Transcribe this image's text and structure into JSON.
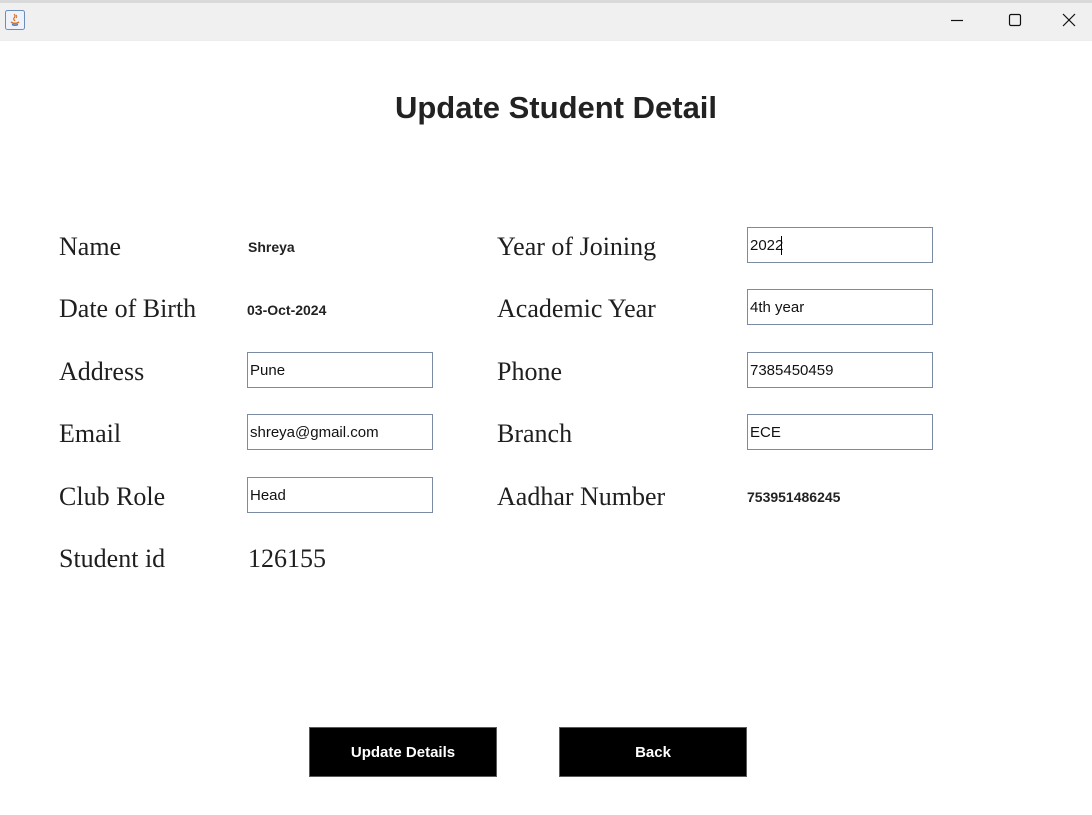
{
  "window": {
    "title": "",
    "controls": {
      "minimize_icon": "minimize-icon",
      "maximize_icon": "maximize-icon",
      "close_icon": "close-icon"
    }
  },
  "page_title": "Update Student Detail",
  "left_column": {
    "name": {
      "label": "Name",
      "value": "Shreya"
    },
    "date_of_birth": {
      "label": "Date of Birth",
      "value": "03-Oct-2024"
    },
    "address": {
      "label": "Address",
      "value": "Pune"
    },
    "email": {
      "label": "Email",
      "value": "shreya@gmail.com"
    },
    "club_role": {
      "label": "Club Role",
      "value": "Head"
    },
    "student_id": {
      "label": "Student id",
      "value": "126155"
    }
  },
  "right_column": {
    "year_of_joining": {
      "label": "Year of Joining",
      "value": "2022"
    },
    "academic_year": {
      "label": "Academic Year",
      "value": "4th year"
    },
    "phone": {
      "label": "Phone",
      "value": "7385450459"
    },
    "branch": {
      "label": "Branch",
      "value": "ECE"
    },
    "aadhar_number": {
      "label": "Aadhar Number",
      "value": "753951486245"
    }
  },
  "buttons": {
    "update": "Update Details",
    "back": "Back"
  },
  "colors": {
    "button_background": "#000000",
    "button_text": "#ffffff",
    "field_border": "#7a8ba3",
    "titlebar": "#f0f0f0"
  }
}
